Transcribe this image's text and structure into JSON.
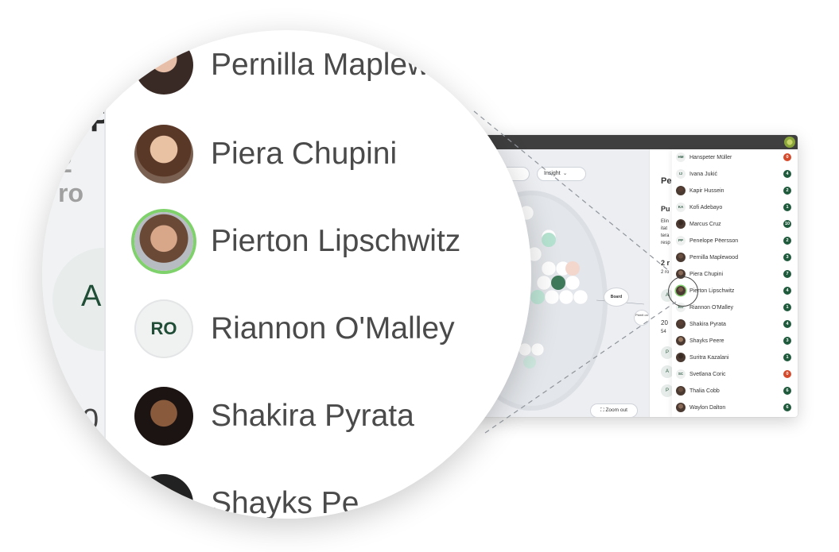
{
  "app": {
    "toolbar": {
      "circles_label": "rcles",
      "insight_label": "Insight",
      "zoom_out_label": "Zoom out"
    },
    "canvas": {
      "board_label": "Board",
      "peer_label": "Peerli on"
    },
    "mid_panel": {
      "title": "Pe",
      "subtitle": "Pu",
      "lines": [
        "Elin",
        "itat",
        "tera",
        "resp"
      ],
      "count_title": "2 r",
      "count_sub": "2 ro",
      "chip_a": "A",
      "number_line": "20",
      "number_line2": "54",
      "chip_p": "P",
      "chip_a2": "A",
      "chip_p2": "P"
    },
    "people": [
      {
        "name": "Hanspeter Müller",
        "initials": "HM",
        "badge": "0",
        "badge_color": "#d64a2c"
      },
      {
        "name": "Ivana Jukić",
        "initials": "IJ",
        "badge": "4",
        "badge_color": "#1f5a3c"
      },
      {
        "name": "Kapir Hussein",
        "initials": "",
        "badge": "2",
        "badge_color": "#1f5a3c"
      },
      {
        "name": "Kofi Adebayo",
        "initials": "KA",
        "badge": "1",
        "badge_color": "#1f5a3c"
      },
      {
        "name": "Marcus Cruz",
        "initials": "",
        "badge": "10",
        "badge_color": "#1f5a3c"
      },
      {
        "name": "Penelope Pëersson",
        "initials": "PP",
        "badge": "2",
        "badge_color": "#1f5a3c"
      },
      {
        "name": "Pernilla Maplewood",
        "initials": "",
        "badge": "3",
        "badge_color": "#1f5a3c"
      },
      {
        "name": "Piera Chupini",
        "initials": "",
        "badge": "7",
        "badge_color": "#1f5a3c"
      },
      {
        "name": "Pierton Lipschwitz",
        "initials": "",
        "badge": "4",
        "badge_color": "#1f5a3c"
      },
      {
        "name": "Riannon O'Malley",
        "initials": "RO",
        "badge": "1",
        "badge_color": "#1f5a3c"
      },
      {
        "name": "Shakira Pyrata",
        "initials": "",
        "badge": "4",
        "badge_color": "#1f5a3c"
      },
      {
        "name": "Shayks Peere",
        "initials": "",
        "badge": "3",
        "badge_color": "#1f5a3c"
      },
      {
        "name": "Suritra Kazalani",
        "initials": "",
        "badge": "1",
        "badge_color": "#1f5a3c"
      },
      {
        "name": "Svetlana Coric",
        "initials": "SC",
        "badge": "0",
        "badge_color": "#d64a2c"
      },
      {
        "name": "Thalia Cobb",
        "initials": "",
        "badge": "6",
        "badge_color": "#1f5a3c"
      },
      {
        "name": "Waylon Dalton",
        "initials": "",
        "badge": "6",
        "badge_color": "#1f5a3c"
      }
    ]
  },
  "magnifier": {
    "left_fragments": {
      "heading": "P",
      "sub": "2 ro",
      "chip": "A",
      "number": "0"
    },
    "rows": [
      {
        "name": "Pernilla Maplew",
        "initials": ""
      },
      {
        "name": "Piera Chupini",
        "initials": ""
      },
      {
        "name": "Pierton Lipschwitz",
        "initials": ""
      },
      {
        "name": "Riannon O'Malley",
        "initials": "RO"
      },
      {
        "name": "Shakira Pyrata",
        "initials": ""
      },
      {
        "name": "Shayks Pe",
        "initials": ""
      }
    ]
  },
  "colors": {
    "accent_green": "#1f5a3c",
    "alert_red": "#d64a2c",
    "highlight_ring": "#7fd16b",
    "link_blue": "#2a62d6"
  }
}
